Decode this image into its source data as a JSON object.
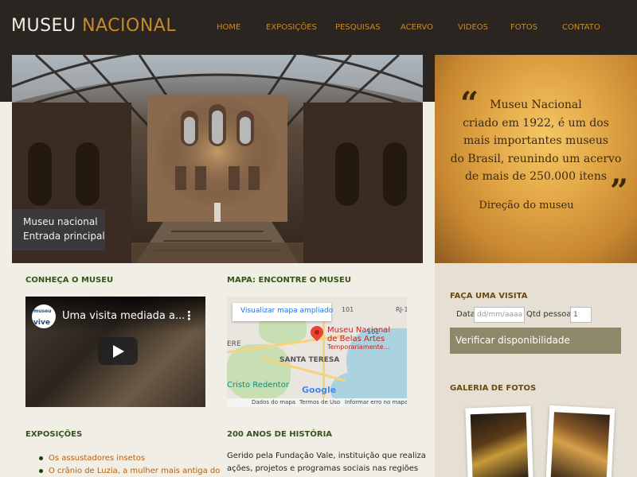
{
  "header": {
    "logo_part1": "MUSEU",
    "logo_part2": "NACIONAL",
    "nav": [
      "HOME",
      "EXPOSIÇÕES",
      "PESQUISAS",
      "ACERVO",
      "VIDEOS",
      "FOTOS",
      "CONTATO"
    ]
  },
  "hero": {
    "caption_line1": "Museu nacional",
    "caption_line2": "Entrada principal"
  },
  "quote": {
    "open_mark": "“",
    "close_mark": "”",
    "lines": [
      "Museu Nacional",
      "criado em 1922, é um dos",
      "mais importantes museus",
      "do Brasil, reunindo um acervo",
      "de mais de 250.000 itens"
    ],
    "signature": "Direção do museu"
  },
  "sections": {
    "conheca_title": "CONHEÇA O MUSEU",
    "mapa_title": "MAPA: ENCONTRE O MUSEU",
    "expo_title": "EXPOSIÇÕES",
    "historia_title": "200 ANOS DE HISTÓRIA"
  },
  "video": {
    "channel_line1": "museu",
    "channel_line2": "vive",
    "title": "Uma visita mediada a...",
    "menu_icon": "⋮"
  },
  "map": {
    "larger_map_link": "Visualizar mapa ampliado",
    "place_name_line1": "Museu Nacional",
    "place_name_line2": "de Belas Artes",
    "place_status": "Temporariamente...",
    "area_label_1": "SANTA TERESA",
    "area_label_2": "Cristo Redentor",
    "road_101a": "101",
    "road_101b": "101",
    "road_rj": "RJ-1",
    "edge_label": "ERE",
    "google_logo": "Google",
    "footer_data": "Dados do mapa",
    "footer_terms": "Termos de Uso",
    "footer_report": "Informar erro no mapa"
  },
  "expo_items": [
    "Os assustadores insetos",
    "O crânio de Luzia, a mulher mais antiga do"
  ],
  "historia_text": [
    "Gerido pela Fundação Vale, instituição que realiza",
    "ações, projetos e programas sociais nas regiões"
  ],
  "visit": {
    "title": "FAÇA UMA VISITA",
    "date_label": "Data",
    "date_placeholder": "dd/mm/aaaa",
    "qty_label": "Qtd pessoas",
    "qty_value": "1",
    "button_label": "Verificar disponibilidade"
  },
  "gallery": {
    "title": "GALERIA DE FOTOS"
  },
  "colors": {
    "header_bg": "#2a2520",
    "accent_gold": "#c68a2c",
    "section_green": "#37521a",
    "sidebar_heading": "#6a4a12",
    "button_bg": "#8f876a"
  }
}
